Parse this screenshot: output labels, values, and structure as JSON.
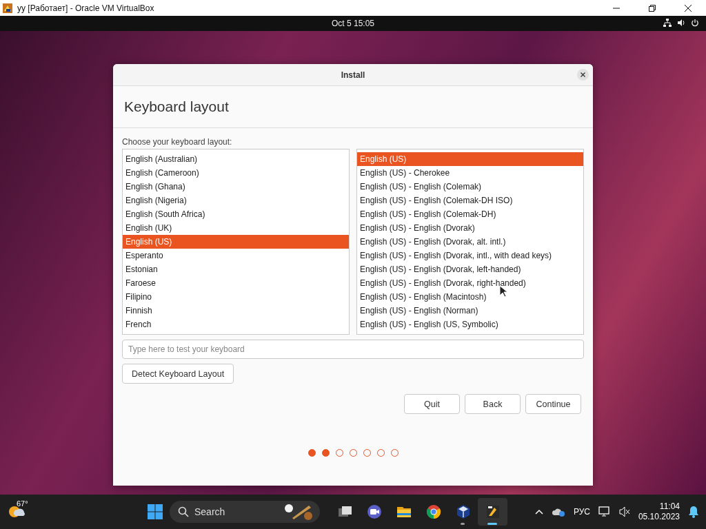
{
  "vm_window": {
    "title": "yy [Работает] - Oracle VM VirtualBox"
  },
  "top_bar": {
    "clock": "Oct 5  15:05"
  },
  "dialog": {
    "title": "Install",
    "heading": "Keyboard layout",
    "prompt": "Choose your keyboard layout:",
    "layouts": [
      {
        "label": "English (Australian)",
        "selected": false
      },
      {
        "label": "English (Cameroon)",
        "selected": false
      },
      {
        "label": "English (Ghana)",
        "selected": false
      },
      {
        "label": "English (Nigeria)",
        "selected": false
      },
      {
        "label": "English (South Africa)",
        "selected": false
      },
      {
        "label": "English (UK)",
        "selected": false
      },
      {
        "label": "English (US)",
        "selected": true
      },
      {
        "label": "Esperanto",
        "selected": false
      },
      {
        "label": "Estonian",
        "selected": false
      },
      {
        "label": "Faroese",
        "selected": false
      },
      {
        "label": "Filipino",
        "selected": false
      },
      {
        "label": "Finnish",
        "selected": false
      },
      {
        "label": "French",
        "selected": false
      }
    ],
    "variants": [
      {
        "label": "English (US)",
        "selected": true
      },
      {
        "label": "English (US) - Cherokee",
        "selected": false
      },
      {
        "label": "English (US) - English (Colemak)",
        "selected": false
      },
      {
        "label": "English (US) - English (Colemak-DH ISO)",
        "selected": false
      },
      {
        "label": "English (US) - English (Colemak-DH)",
        "selected": false
      },
      {
        "label": "English (US) - English (Dvorak)",
        "selected": false
      },
      {
        "label": "English (US) - English (Dvorak, alt. intl.)",
        "selected": false
      },
      {
        "label": "English (US) - English (Dvorak, intl., with dead keys)",
        "selected": false
      },
      {
        "label": "English (US) - English (Dvorak, left-handed)",
        "selected": false
      },
      {
        "label": "English (US) - English (Dvorak, right-handed)",
        "selected": false
      },
      {
        "label": "English (US) - English (Macintosh)",
        "selected": false
      },
      {
        "label": "English (US) - English (Norman)",
        "selected": false
      },
      {
        "label": "English (US) - English (US, Symbolic)",
        "selected": false
      }
    ],
    "test_field": {
      "placeholder": "Type here to test your keyboard"
    },
    "detect_button": "Detect Keyboard Layout",
    "buttons": [
      "Quit",
      "Back",
      "Continue"
    ],
    "steps": [
      {
        "done": true
      },
      {
        "done": true
      },
      {
        "done": false
      },
      {
        "done": false
      },
      {
        "done": false
      },
      {
        "done": false
      },
      {
        "done": false
      }
    ]
  },
  "taskbar": {
    "weather": "67°",
    "search": {
      "placeholder": "Search"
    },
    "apps": [
      {
        "kind": "task-view",
        "running": false,
        "active": false
      },
      {
        "kind": "meet",
        "running": false,
        "active": false
      },
      {
        "kind": "folder",
        "running": false,
        "active": false
      },
      {
        "kind": "chrome",
        "running": false,
        "active": false
      },
      {
        "kind": "virtualbox",
        "running": true,
        "active": false
      },
      {
        "kind": "vm",
        "running": true,
        "active": true
      }
    ],
    "language": "РУС",
    "time": "11:04",
    "date": "05.10.2023"
  }
}
